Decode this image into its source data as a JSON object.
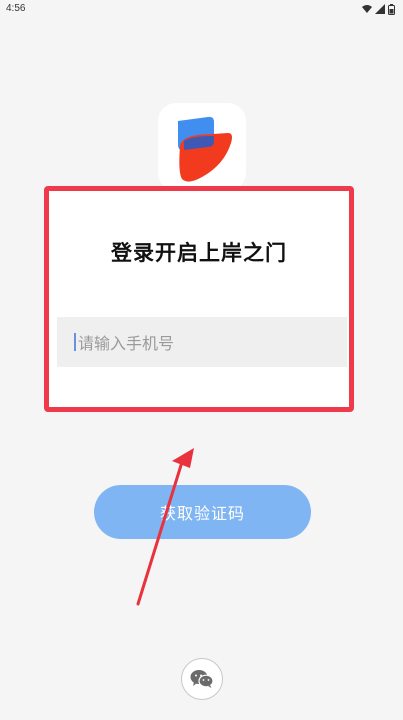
{
  "status_bar": {
    "time": "4:56",
    "icons": [
      "wifi-icon",
      "signal-icon",
      "battery-icon"
    ]
  },
  "app": {
    "logo": "app-logo-icon"
  },
  "login": {
    "title": "登录开启上岸之门",
    "phone_placeholder": "请输入手机号",
    "get_code_label": "获取验证码"
  },
  "third_party": {
    "wechat_icon": "wechat-icon"
  },
  "annotation": {
    "box_color": "#ee3a4a",
    "arrow_color": "#e8323e"
  },
  "colors": {
    "primary_button": "#7fb5f2",
    "logo_blue": "#3f8ef0",
    "logo_red": "#f23a1f"
  }
}
